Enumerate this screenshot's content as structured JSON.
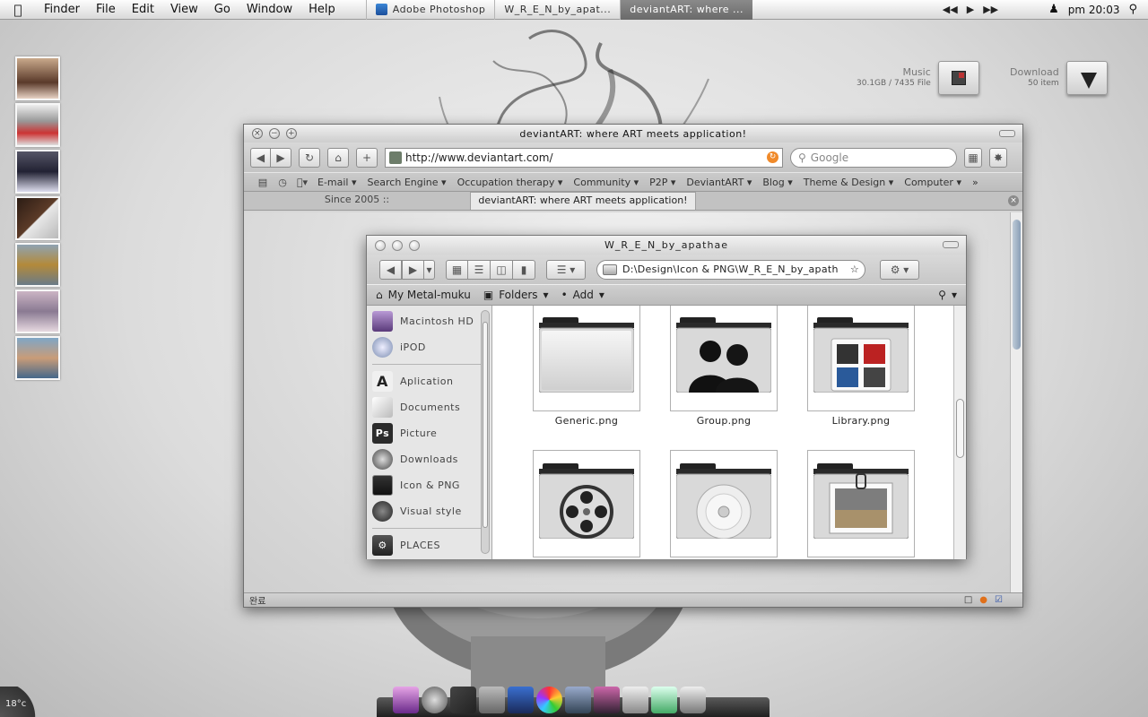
{
  "menubar": {
    "app_name": "Finder",
    "menus": [
      "File",
      "Edit",
      "View",
      "Go",
      "Window",
      "Help"
    ],
    "tasks": [
      {
        "label": "Adobe Photoshop",
        "active": false
      },
      {
        "label": "W_R_E_N_by_apat...",
        "active": false
      },
      {
        "label": "deviantART: where ...",
        "active": true
      }
    ],
    "clock": "pm 20:03",
    "media_controls": [
      "previous-icon",
      "play-icon",
      "next-icon"
    ]
  },
  "desktop": {
    "stacks": [
      {
        "name": "Music",
        "detail": "30.1GB / 7435 File"
      },
      {
        "name": "Download",
        "detail": "50  item"
      }
    ],
    "photo_count": 7,
    "weather": "18°c"
  },
  "browser": {
    "title": "deviantART: where ART meets application!",
    "url": "http://www.deviantart.com/",
    "search_placeholder": "Google",
    "bookmarks": [
      "E-mail",
      "Search Engine",
      "Occupation therapy",
      "Community",
      "P2P",
      "DeviantART",
      "Blog",
      "Theme & Design",
      "Computer"
    ],
    "tabs": [
      {
        "label": "Since 2005 ::",
        "active": false
      },
      {
        "label": "deviantART: where ART meets application!",
        "active": true
      }
    ],
    "status": "완료"
  },
  "finder": {
    "title": "W_R_E_N_by_apathae",
    "path": "D:\\Design\\Icon & PNG\\W_R_E_N_by_apath",
    "places_bar": {
      "home": "My  Metal-muku",
      "folders": "Folders",
      "add": "Add"
    },
    "sidebar": [
      {
        "label": "Macintosh HD",
        "icon": "hard-drive-icon"
      },
      {
        "label": "iPOD",
        "icon": "ipod-icon"
      },
      {
        "label": "Aplication",
        "icon": "applications-icon"
      },
      {
        "label": "Documents",
        "icon": "documents-icon"
      },
      {
        "label": "Picture",
        "icon": "photoshop-icon"
      },
      {
        "label": "Downloads",
        "icon": "downloads-icon"
      },
      {
        "label": "Icon & PNG",
        "icon": "monitor-icon"
      },
      {
        "label": "Visual style",
        "icon": "dial-icon"
      },
      {
        "label": "PLACES",
        "icon": "places-icon"
      }
    ],
    "files": [
      {
        "name": "Generic.png",
        "icon": "generic-folder-icon"
      },
      {
        "name": "Group.png",
        "icon": "group-folder-icon"
      },
      {
        "name": "Library.png",
        "icon": "library-folder-icon"
      },
      {
        "name": "",
        "icon": "movies-folder-icon"
      },
      {
        "name": "",
        "icon": "cd-folder-icon"
      },
      {
        "name": "",
        "icon": "pictures-folder-icon"
      }
    ]
  },
  "dock": {
    "items": [
      "photo-icon",
      "compass-icon",
      "pen-icon",
      "palette-icon",
      "flask-icon",
      "cd-icon",
      "screen-icon",
      "monitor-icon",
      "library-icon",
      "download-icon",
      "disk-icon"
    ]
  }
}
